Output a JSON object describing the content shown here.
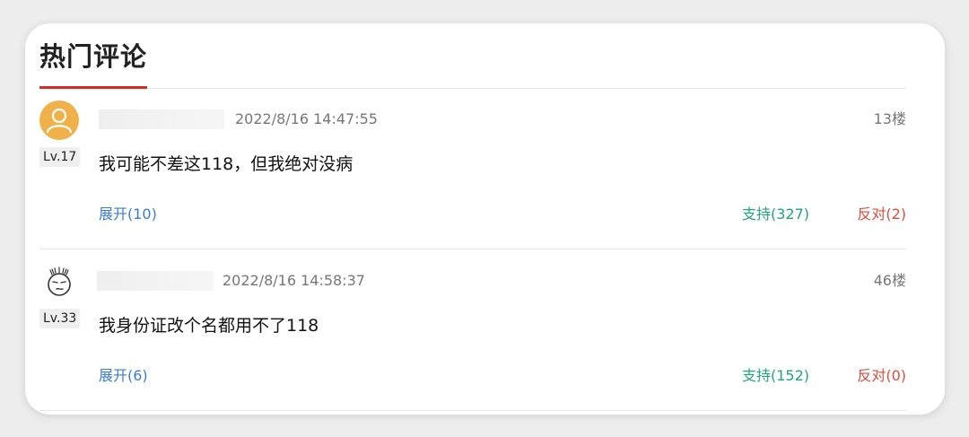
{
  "section": {
    "title": "热门评论",
    "accent_color": "#d82a22"
  },
  "comments": [
    {
      "avatar_icon": "default-user-avatar-icon",
      "level": "Lv.17",
      "time": "2022/8/16 14:47:55",
      "floor": "13楼",
      "content": "我可能不差这118，但我绝对没病",
      "expand": "展开(10)",
      "support": "支持(327)",
      "oppose": "反对(2)"
    },
    {
      "avatar_icon": "doodle-face-avatar-icon",
      "level": "Lv.33",
      "time": "2022/8/16 14:58:37",
      "floor": "46楼",
      "content": "我身份证改个名都用不了118",
      "expand": "展开(6)",
      "support": "支持(152)",
      "oppose": "反对(0)"
    }
  ],
  "colors": {
    "link_blue": "#3a7bd5",
    "support_green": "#1fa67a",
    "oppose_red": "#e04a3a"
  }
}
